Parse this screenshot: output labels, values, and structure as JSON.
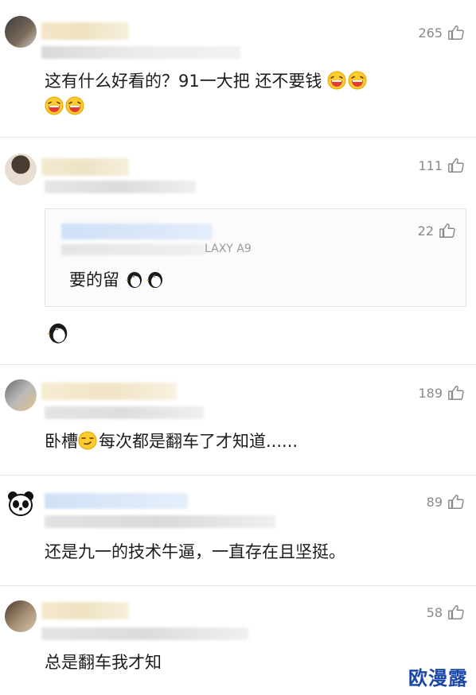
{
  "comments": [
    {
      "likes": "265",
      "text": "这有什么好看的？91一大把 还不要钱",
      "emoji": "laugh"
    },
    {
      "likes": "111",
      "text": "",
      "reply": {
        "likes": "22",
        "meta_visible": "LAXY A9",
        "text": "要的留"
      }
    },
    {
      "likes": "189",
      "text_before": "卧槽",
      "text_after": "每次都是翻车了才知道......"
    },
    {
      "likes": "89",
      "text": "还是九一的技术牛逼，一直存在且坚挺。"
    },
    {
      "likes": "58",
      "text": "总是翻车我才知"
    }
  ],
  "watermark": "欧漫露",
  "colors": {
    "like_gray": "#8a8a8a",
    "watermark_blue": "#1a47a8",
    "divider": "#e6e6e6"
  }
}
